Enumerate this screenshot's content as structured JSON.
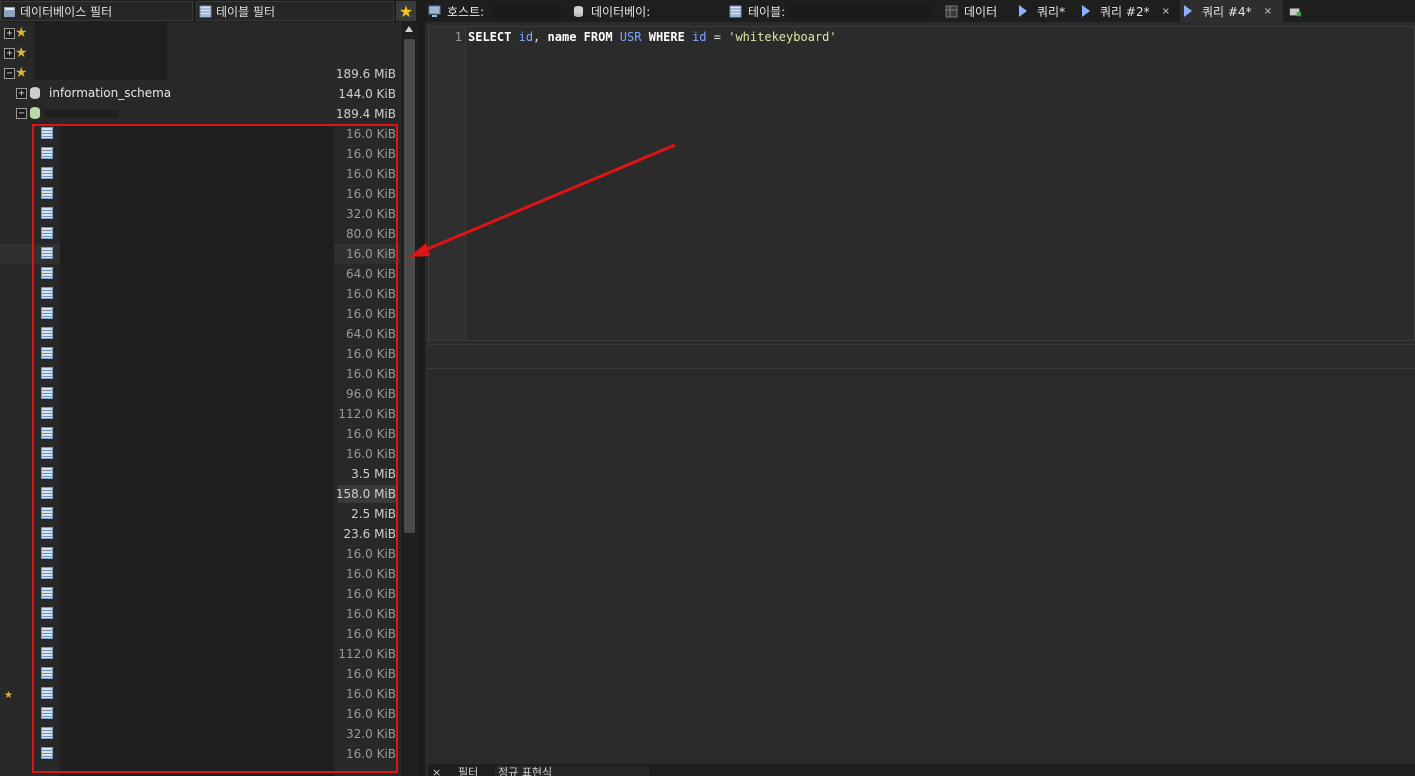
{
  "filters": {
    "database_filter_label": "데이터베이스 필터",
    "table_filter_label": "테이블 필터"
  },
  "tree": {
    "server_size": "189.6 MiB",
    "information_schema": {
      "name": "information_schema",
      "size": "144.0 KiB"
    },
    "active_db_size": "189.4 MiB",
    "table_sizes": [
      "16.0 KiB",
      "16.0 KiB",
      "16.0 KiB",
      "16.0 KiB",
      "32.0 KiB",
      "80.0 KiB",
      "16.0 KiB",
      "64.0 KiB",
      "16.0 KiB",
      "16.0 KiB",
      "64.0 KiB",
      "16.0 KiB",
      "16.0 KiB",
      "96.0 KiB",
      "112.0 KiB",
      "16.0 KiB",
      "16.0 KiB",
      "3.5 MiB",
      "158.0 MiB",
      "2.5 MiB",
      "23.6 MiB",
      "16.0 KiB",
      "16.0 KiB",
      "16.0 KiB",
      "16.0 KiB",
      "16.0 KiB",
      "112.0 KiB",
      "16.0 KiB",
      "16.0 KiB",
      "16.0 KiB",
      "32.0 KiB",
      "16.0 KiB"
    ]
  },
  "tabs": {
    "host": "호스트:",
    "database": "데이터베이:",
    "table": "테이블:",
    "data": "데이터",
    "query1": "쿼리*",
    "query2": "쿼리 #2*",
    "query4": "쿼리 #4*",
    "close_glyph": "×"
  },
  "editor": {
    "line_number": "1",
    "sql": {
      "select": "SELECT",
      "id": "id",
      "comma": ",",
      "name": "name",
      "from": "FROM",
      "table": "USR",
      "where": "WHERE",
      "id2": "id",
      "eq": "=",
      "value": "'whitekeyboard'"
    }
  },
  "bottom": {
    "tab1": "필터",
    "tab2": "정규 표현식"
  },
  "icons": {
    "favorites": "star-icon",
    "table": "table-icon",
    "database": "database-icon",
    "query": "query-play-icon"
  },
  "colors": {
    "annotation": "#e01414",
    "favorite": "#d9b43a",
    "keyword_id": "#7fa7ff",
    "string": "#d7e9a5"
  }
}
